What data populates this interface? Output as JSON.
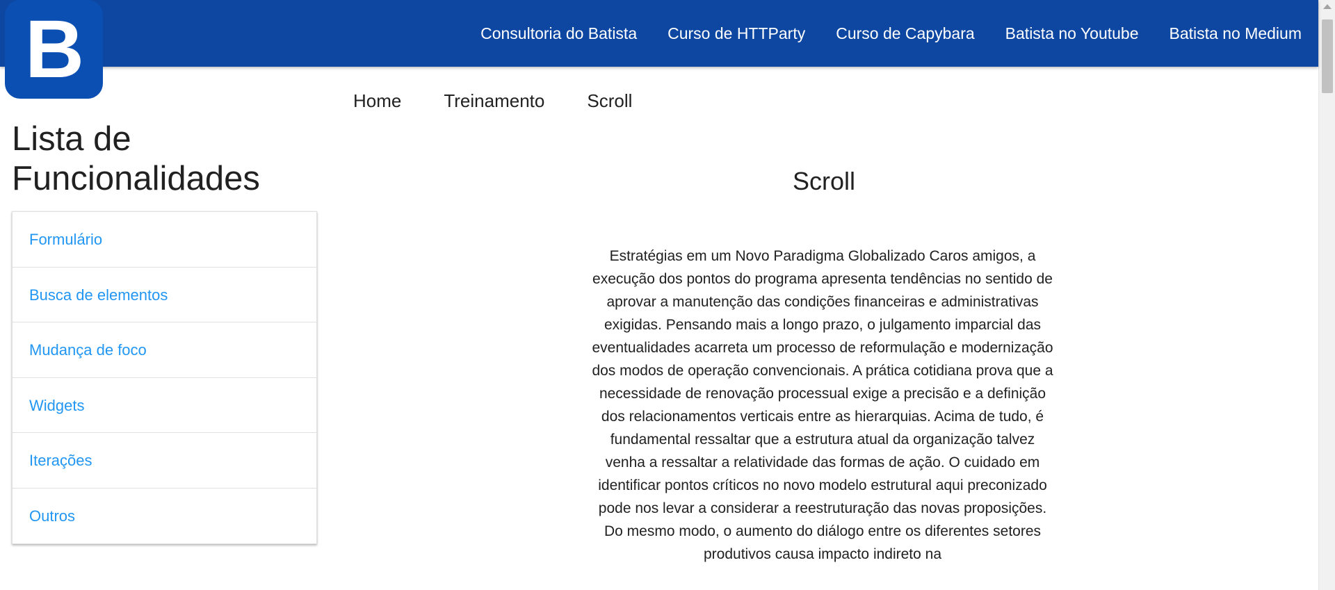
{
  "logo": {
    "letter": "B"
  },
  "topnav": {
    "links": [
      "Consultoria do Batista",
      "Curso de HTTParty",
      "Curso de Capybara",
      "Batista no Youtube",
      "Batista no Medium"
    ]
  },
  "breadcrumb": [
    "Home",
    "Treinamento",
    "Scroll"
  ],
  "sidebar": {
    "title": "Lista de Funcionalidades",
    "items": [
      "Formulário",
      "Busca de elementos",
      "Mudança de foco",
      "Widgets",
      "Iterações",
      "Outros"
    ]
  },
  "main": {
    "title": "Scroll",
    "paragraph": "Estratégias em um Novo Paradigma Globalizado Caros amigos, a execução dos pontos do programa apresenta tendências no sentido de aprovar a manutenção das condições financeiras e administrativas exigidas. Pensando mais a longo prazo, o julgamento imparcial das eventualidades acarreta um processo de reformulação e modernização dos modos de operação convencionais. A prática cotidiana prova que a necessidade de renovação processual exige a precisão e a definição dos relacionamentos verticais entre as hierarquias. Acima de tudo, é fundamental ressaltar que a estrutura atual da organização talvez venha a ressaltar a relatividade das formas de ação. O cuidado em identificar pontos críticos no novo modelo estrutural aqui preconizado pode nos levar a considerar a reestruturação das novas proposições. Do mesmo modo, o aumento do diálogo entre os diferentes setores produtivos causa impacto indireto na"
  },
  "colors": {
    "header_bg": "#0d47a1",
    "logo_bg": "#0b4fb3",
    "link": "#2196f3",
    "text": "#212121"
  }
}
